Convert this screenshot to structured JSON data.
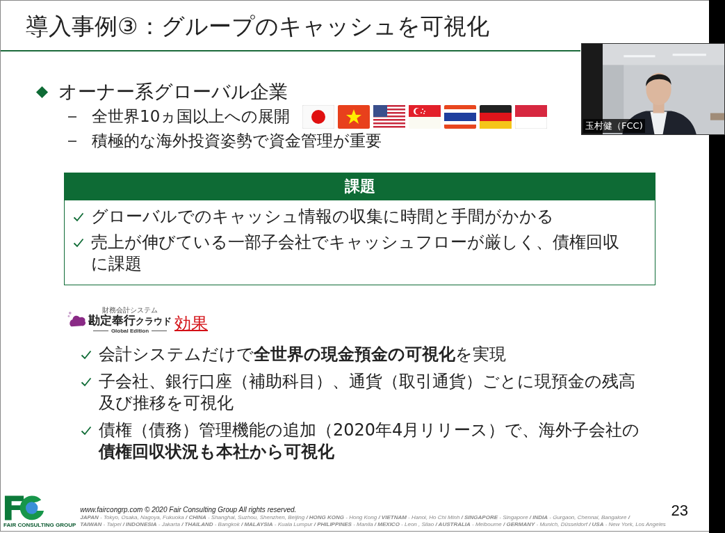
{
  "slide": {
    "title": "導入事例③：グループのキャッシュを可視化",
    "bullets": [
      {
        "text": "オーナー系グローバル企業",
        "children": [
          {
            "text": "全世界10ヵ国以上への展開",
            "flags": true
          },
          {
            "text": "積極的な海外投資姿勢で資金管理が重要",
            "flags": false
          }
        ]
      }
    ],
    "issue_box": {
      "heading": "課題",
      "items": [
        "グローバルでのキャッシュ情報の収集に時間と手間がかかる",
        "売上が伸びている一部子会社でキャッシュフローが厳しく、債権回収に課題"
      ]
    },
    "effect": {
      "logo": {
        "tagline": "財務会計システム",
        "name": "勘定奉行",
        "suffix": "クラウド",
        "edition": "Global Edition"
      },
      "heading": "効果",
      "items": [
        "会計システムだけで**全世界の現金預金の可視化**を実現",
        "子会社、銀行口座（補助科目）、通貨（取引通貨）ごとに現預金の残高及び推移を可視化",
        "債権（債務）管理機能の追加（2020年4月リリース）で、海外子会社の**債権回収状況も本社から可視化**"
      ]
    },
    "footer": {
      "logo_caption": "FAIR CONSULTING GROUP",
      "copyright": "www.faircongrp.com © 2020 Fair Consulting Group All rights reserved.",
      "offices": [
        "**JAPAN** - Tokyo, Osaka, Nagoya, Fukuoka **/ CHINA** - Shanghai, Suzhou, Shenzhen, Beijing **/ HONG KONG** - Hong Kong **/ VIETNAM** - Hanoi, Ho Chi Minh **/ SINGAPORE** - Singapore **/ INDIA** - Gurgaon, Chennai, Bangalore **/**",
        "**TAIWAN** - Taipei **/ INDONESIA** - Jakarta **/ THAILAND** - Bangkok **/ MALAYSIA** - Kuala Lumpur **/ PHILIPPINES** - Manila **/ MEXICO** - Leon , Silao **/ AUSTRALIA** - Melbourne **/ GERMANY** - Munich, Düsseldorf **/ USA** - New York, Los Angeles"
      ],
      "page": "23"
    }
  },
  "video": {
    "kind": "picture",
    "name": "玉村健（FCC)"
  }
}
